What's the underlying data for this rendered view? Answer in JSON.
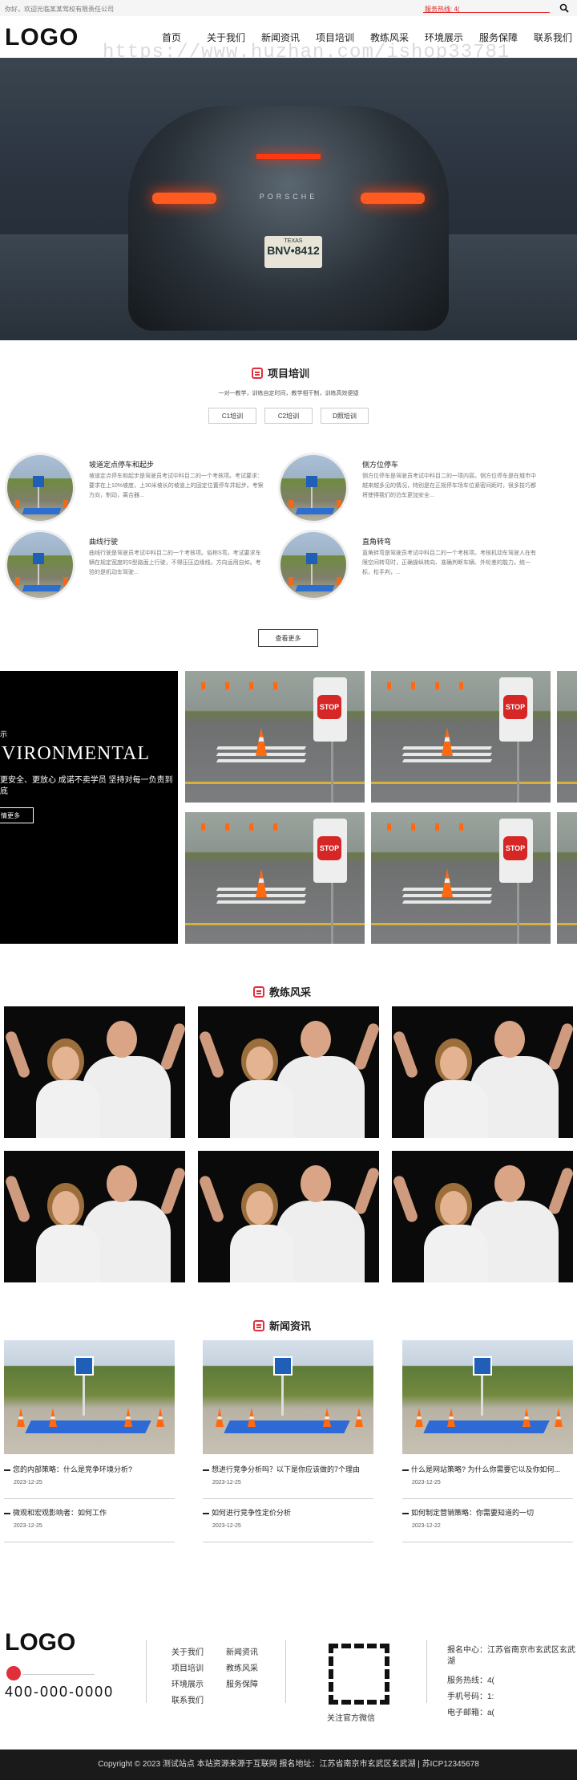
{
  "topbar": {
    "welcome": "你好，欢迎光临某某驾校有限责任公司",
    "hotline": "服务热线: 4("
  },
  "header": {
    "logo": "LOGO",
    "watermark": "https://www.huzhan.com/ishop33781"
  },
  "nav": [
    "首页",
    "关于我们",
    "新闻资讯",
    "项目培训",
    "教练风采",
    "环境展示",
    "服务保障",
    "联系我们"
  ],
  "banner": {
    "plate_state": "TEXAS",
    "plate_number": "BNV•8412",
    "brand": "PORSCHE",
    "colors": {
      "active_dot": "#e02020",
      "dot": "#ffffff"
    }
  },
  "project": {
    "title": "项目培训",
    "subtitle": "一对一教学，训练自定时间，教学相干制，训练高效便捷",
    "tabs": [
      "C1培训",
      "C2培训",
      "D照培训"
    ],
    "items": [
      {
        "name": "坡道定点停车和起步",
        "desc": "坡道定点停车和起步是驾驶员考试中科目二的一个考核项。考试要求：要求在上10%坡度，上30米坡长的坡道上的固定位置停车并起步。考察方向，制动，离合器..."
      },
      {
        "name": "侧方位停车",
        "desc": "侧方位停车是驾驶员考试中科目二的一项内容。侧方位停车是在城市中越来越多见的情况，特别是在正规停车场车位紧密间距时，很多技巧都将使得我们的泊车更加安全..."
      },
      {
        "name": "曲线行驶",
        "desc": "曲线行驶是驾驶员考试中科目二的一个考核项。俗称S弯。考试要求车辆在规定宽度的S型路面上行驶，不得压压边缘线，方向运用自如。考验的是机动车驾驶..."
      },
      {
        "name": "直角转弯",
        "desc": "直角转弯是驾驶员考试中科目二的一个考核项。考核机动车驾驶人在有限空间转弯时，正确操纵转向、准确判断车辆、外轮差的能力。统一标，松手判，..."
      }
    ],
    "more": "查看更多"
  },
  "environment": {
    "caption": "示",
    "heading": "VIRONMENTAL",
    "text": "更安全、更放心 成诺不卖学员 坚持对每一负责到底",
    "button": "情更多",
    "stop_text": "STOP"
  },
  "coach": {
    "title": "教练风采"
  },
  "news": {
    "title": "新闻资讯",
    "columns": [
      [
        {
          "title": "您的内部策略：什么是竞争环境分析?",
          "date": "2023-12-25"
        },
        {
          "title": "微观和宏观影响者：如何工作",
          "date": "2023-12-25"
        }
      ],
      [
        {
          "title": "想进行竞争分析吗？以下是你应该做的7个理由",
          "date": "2023-12-25"
        },
        {
          "title": "如何进行竞争性定价分析",
          "date": "2023-12-25"
        }
      ],
      [
        {
          "title": "什么是网站策略? 为什么你需要它以及你如何...",
          "date": "2023-12-25"
        },
        {
          "title": "如何制定营销策略：你需要知道的一切",
          "date": "2023-12-22"
        }
      ]
    ]
  },
  "footer": {
    "logo": "LOGO",
    "phone": "400-000-0000",
    "links_col1": [
      "关于我们",
      "项目培训",
      "环境展示",
      "联系我们"
    ],
    "links_col2": [
      "新闻资讯",
      "教练风采",
      "服务保障"
    ],
    "qr_caption": "关注官方微信",
    "info": [
      "报名中心：江苏省南京市玄武区玄武湖",
      "服务热线：4(",
      "手机号码：1:",
      "电子邮箱：a(                                          .com"
    ],
    "copyright": "Copyright © 2023 测试站点 本站资源来源于互联网  报名地址：江苏省南京市玄武区玄武湖 | 苏ICP12345678"
  }
}
